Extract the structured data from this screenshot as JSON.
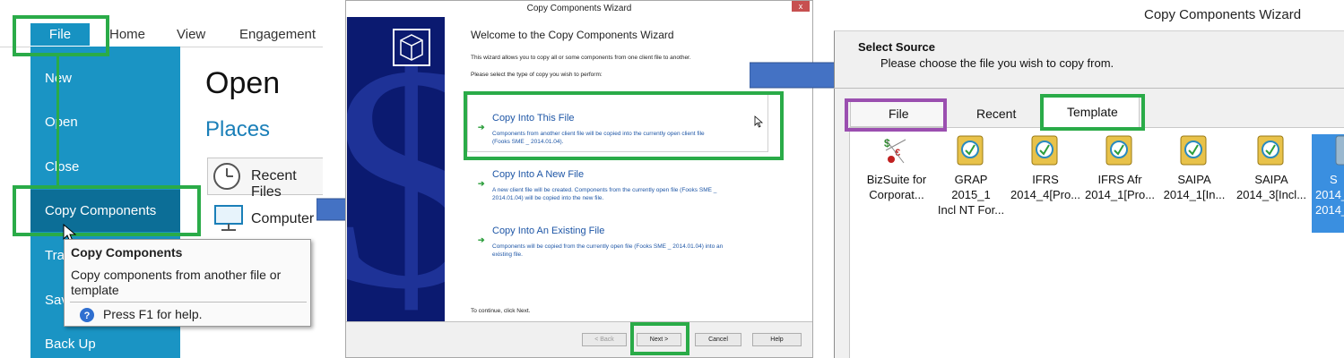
{
  "left_panel": {
    "ribbon_tabs": [
      "File",
      "Home",
      "View",
      "Engagement"
    ],
    "backstage_menu": [
      "New",
      "Open",
      "Close",
      "Copy Components",
      "Tra",
      "Sav",
      "Back Up"
    ],
    "open_heading": "Open",
    "places_heading": "Places",
    "recent_files": "Recent Files",
    "computer": "Computer",
    "tooltip": {
      "title": "Copy Components",
      "body": "Copy components from another file or template",
      "help": "Press F1 for help."
    }
  },
  "wizard": {
    "title": "Copy Components Wizard",
    "close": "x",
    "heading": "Welcome to the Copy Components Wizard",
    "intro": "This wizard allows you to copy all or some components from one client file to another.",
    "prompt": "Please select the type of copy you wish to perform:",
    "options": [
      {
        "title": "Copy Into This File",
        "desc1": "Components from another client file will be copied into the currently open client file",
        "desc2": "(Fooks SME _ 2014.01.04)."
      },
      {
        "title": "Copy Into A New File",
        "desc1": "A new client file will be created. Components from the currently open file (Fooks SME _",
        "desc2": "2014.01.04) will be copied into the new file."
      },
      {
        "title": "Copy Into An Existing File",
        "desc1": "Components will be copied from the currently open file (Fooks SME _ 2014.01.04) into an",
        "desc2": "existing file."
      }
    ],
    "footer": "To continue, click Next.",
    "buttons": {
      "back": "< Back",
      "next": "Next >",
      "cancel": "Cancel",
      "help": "Help"
    }
  },
  "select_source": {
    "title": "Copy Components Wizard",
    "heading": "Select Source",
    "instruction": "Please choose the file you wish to copy from.",
    "tabs": [
      "File",
      "Recent",
      "Template"
    ],
    "templates": [
      {
        "line1": "BizSuite for",
        "line2": "Corporat..."
      },
      {
        "line1": "GRAP 2015_1",
        "line2": "Incl NT For..."
      },
      {
        "line1": "IFRS",
        "line2": "2014_4[Pro..."
      },
      {
        "line1": "IFRS Afr",
        "line2": "2014_1[Pro..."
      },
      {
        "line1": "SAIPA",
        "line2": "2014_1[In..."
      },
      {
        "line1": "SAIPA",
        "line2": "2014_3[Incl..."
      },
      {
        "line1": "S",
        "line2": "2014_"
      }
    ]
  },
  "colors": {
    "highlight_green": "#2aab48",
    "highlight_purple": "#9b4fb0",
    "backstage_blue": "#1a94c4",
    "arrow_blue": "#4472c4"
  }
}
